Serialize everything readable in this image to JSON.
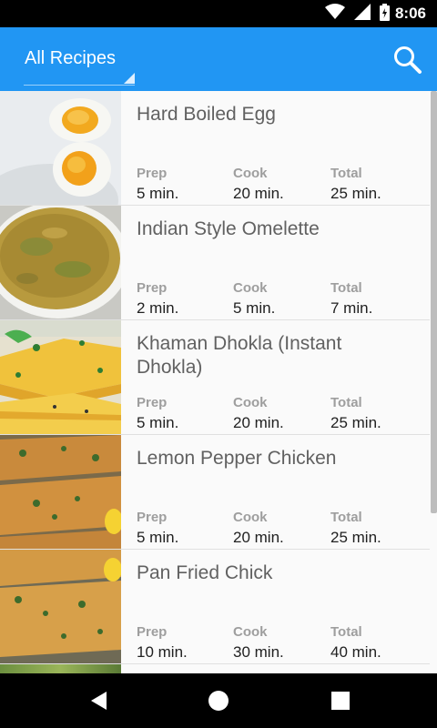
{
  "status_bar": {
    "time": "8:06",
    "icons": [
      "wifi-icon",
      "signal-icon",
      "battery-icon"
    ]
  },
  "app_bar": {
    "title": "All Recipes",
    "search_icon": "search-icon",
    "color": "#2196f3"
  },
  "labels": {
    "prep": "Prep",
    "cook": "Cook",
    "total": "Total"
  },
  "recipes": [
    {
      "title": "Hard Boiled Egg",
      "prep": "5 min.",
      "cook": "20 min.",
      "total": "25 min.",
      "image": "boiled-egg-photo"
    },
    {
      "title": "Indian Style Omelette",
      "prep": "2 min.",
      "cook": "5 min.",
      "total": "7 min.",
      "image": "omelette-photo"
    },
    {
      "title": "Khaman Dhokla (Instant Dhokla)",
      "prep": "5 min.",
      "cook": "20 min.",
      "total": "25 min.",
      "image": "dhokla-photo"
    },
    {
      "title": "Lemon Pepper Chicken",
      "prep": "5 min.",
      "cook": "20 min.",
      "total": "25 min.",
      "image": "lemon-chicken-photo"
    },
    {
      "title": "Pan Fried Chick",
      "prep": "10 min.",
      "cook": "30 min.",
      "total": "40 min.",
      "image": "pan-fried-chicken-photo"
    }
  ],
  "nav_bar": {
    "icons": [
      "back-icon",
      "home-icon",
      "recents-icon"
    ]
  }
}
